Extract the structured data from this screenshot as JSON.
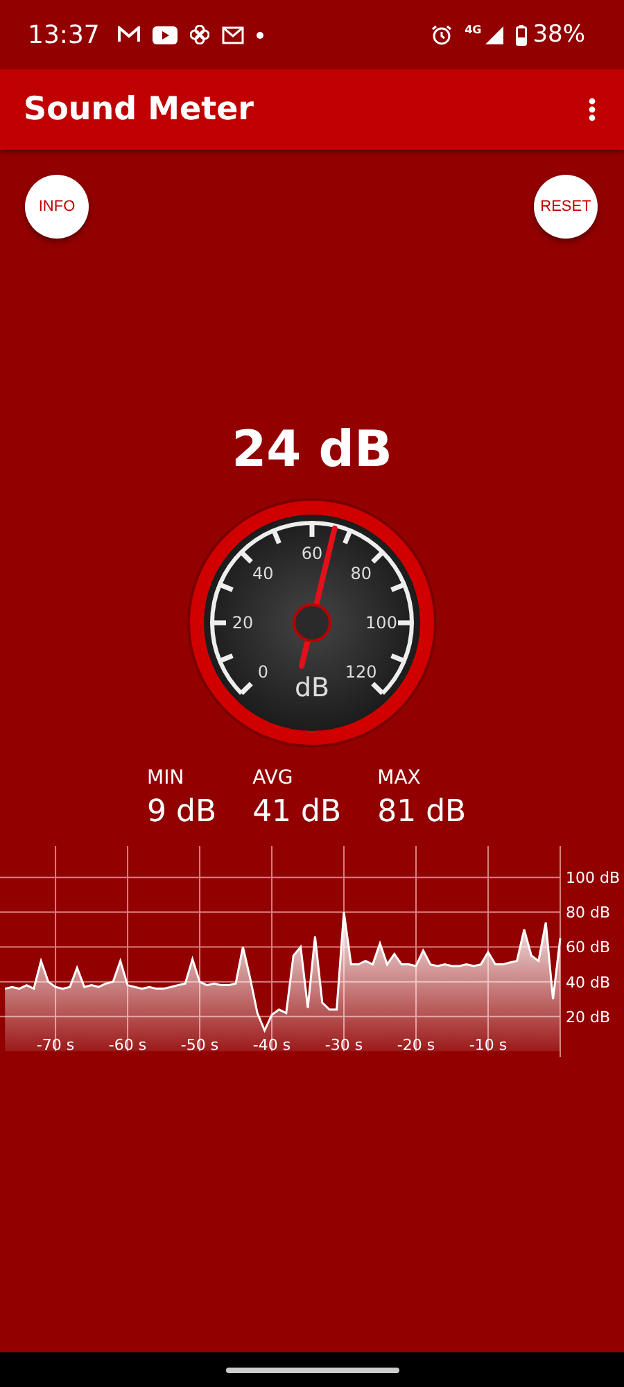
{
  "status_bar": {
    "time": "13:37",
    "battery": "38%",
    "network": "4G"
  },
  "app_bar": {
    "title": "Sound Meter"
  },
  "buttons": {
    "info": "INFO",
    "reset": "RESET"
  },
  "reading": "24 dB",
  "gauge": {
    "unit": "dB",
    "scale_labels": [
      "0",
      "20",
      "40",
      "60",
      "80",
      "100",
      "120"
    ]
  },
  "stats": [
    {
      "label": "MIN",
      "value": "9 dB"
    },
    {
      "label": "AVG",
      "value": "41 dB"
    },
    {
      "label": "MAX",
      "value": "81 dB"
    }
  ],
  "chart_data": {
    "type": "area",
    "x": [
      -77,
      -76,
      -75,
      -74,
      -73,
      -72,
      -71,
      -70,
      -69,
      -68,
      -67,
      -66,
      -65,
      -64,
      -63,
      -62,
      -61,
      -60,
      -59,
      -58,
      -57,
      -56,
      -55,
      -54,
      -53,
      -52,
      -51,
      -50,
      -49,
      -48,
      -47,
      -46,
      -45,
      -44,
      -43,
      -42,
      -41,
      -40,
      -39,
      -38,
      -37,
      -36,
      -35,
      -34,
      -33,
      -32,
      -31,
      -30,
      -29,
      -28,
      -27,
      -26,
      -25,
      -24,
      -23,
      -22,
      -21,
      -20,
      -19,
      -18,
      -17,
      -16,
      -15,
      -14,
      -13,
      -12,
      -11,
      -10,
      -9,
      -8,
      -7,
      -6,
      -5,
      -4,
      -3,
      -2,
      -1,
      0
    ],
    "xlim": [
      -77.7,
      0
    ],
    "ylim": [
      0,
      118
    ],
    "grid": true,
    "series": [
      {
        "color": "#ffffff",
        "values": [
          36,
          37,
          36,
          38,
          36,
          52,
          40,
          37,
          36,
          37,
          48,
          37,
          38,
          37,
          39,
          40,
          52,
          38,
          37,
          36,
          37,
          36,
          36,
          37,
          38,
          39,
          53,
          40,
          38,
          39,
          38,
          38,
          39,
          60,
          42,
          22,
          12,
          21,
          24,
          22,
          55,
          60,
          25,
          66,
          28,
          24,
          24,
          80,
          50,
          50,
          52,
          50,
          62,
          50,
          56,
          50,
          50,
          49,
          58,
          50,
          49,
          50,
          49,
          49,
          50,
          49,
          50,
          57,
          50,
          50,
          51,
          52,
          70,
          55,
          52,
          74,
          30,
          65
        ]
      }
    ],
    "xticks": [
      {
        "value": -70,
        "label": "-70 s"
      },
      {
        "value": -60,
        "label": "-60 s"
      },
      {
        "value": -50,
        "label": "-50 s"
      },
      {
        "value": -40,
        "label": "-40 s"
      },
      {
        "value": -30,
        "label": "-30 s"
      },
      {
        "value": -20,
        "label": "-20 s"
      },
      {
        "value": -10,
        "label": "-10 s"
      }
    ],
    "yticks": [
      {
        "value": 20,
        "label": "20 dB"
      },
      {
        "value": 40,
        "label": "40 dB"
      },
      {
        "value": 60,
        "label": "60 dB"
      },
      {
        "value": 80,
        "label": "80 dB"
      },
      {
        "value": 100,
        "label": "100 dB"
      }
    ]
  }
}
